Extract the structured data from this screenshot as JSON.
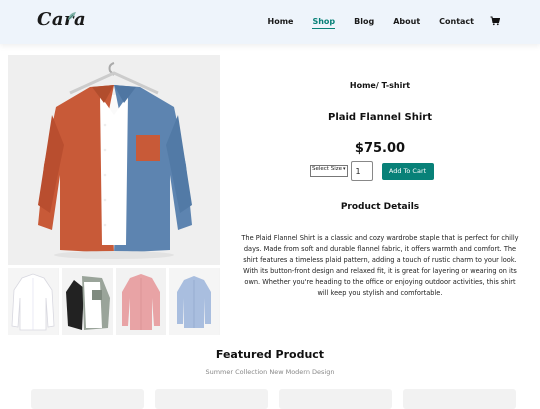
{
  "header": {
    "logo_text": "Cara",
    "nav": [
      "Home",
      "Shop",
      "Blog",
      "About",
      "Contact"
    ],
    "active_nav": "Shop",
    "cart_icon": "cart-icon",
    "accent_color": "#088178",
    "background_color": "#eef4fb"
  },
  "product": {
    "breadcrumb": "Home/ T-shirt",
    "title": "Plaid Flannel Shirt",
    "price": "$75.00",
    "size_select_value": "Select Size",
    "quantity": "1",
    "add_to_cart_label": "Add To Cart",
    "details_heading": "Product Details",
    "description": "The Plaid Flannel Shirt is a classic and cozy wardrobe staple that is perfect for chilly days. Made from soft and durable flannel fabric, it offers warmth and comfort. The shirt features a timeless plaid pattern, adding a touch of rustic charm to your look. With its button-front design and relaxed fit, it is great for layering or wearing on its own. Whether you're heading to the office or enjoying outdoor activities, this shirt will keep you stylish and comfortable.",
    "thumbnails": [
      "white-shirt",
      "grey-black-shirt",
      "pink-shirt",
      "blue-shirt"
    ]
  },
  "featured": {
    "title": "Featured Product",
    "subtitle": "Summer Collection New Modern Design"
  }
}
